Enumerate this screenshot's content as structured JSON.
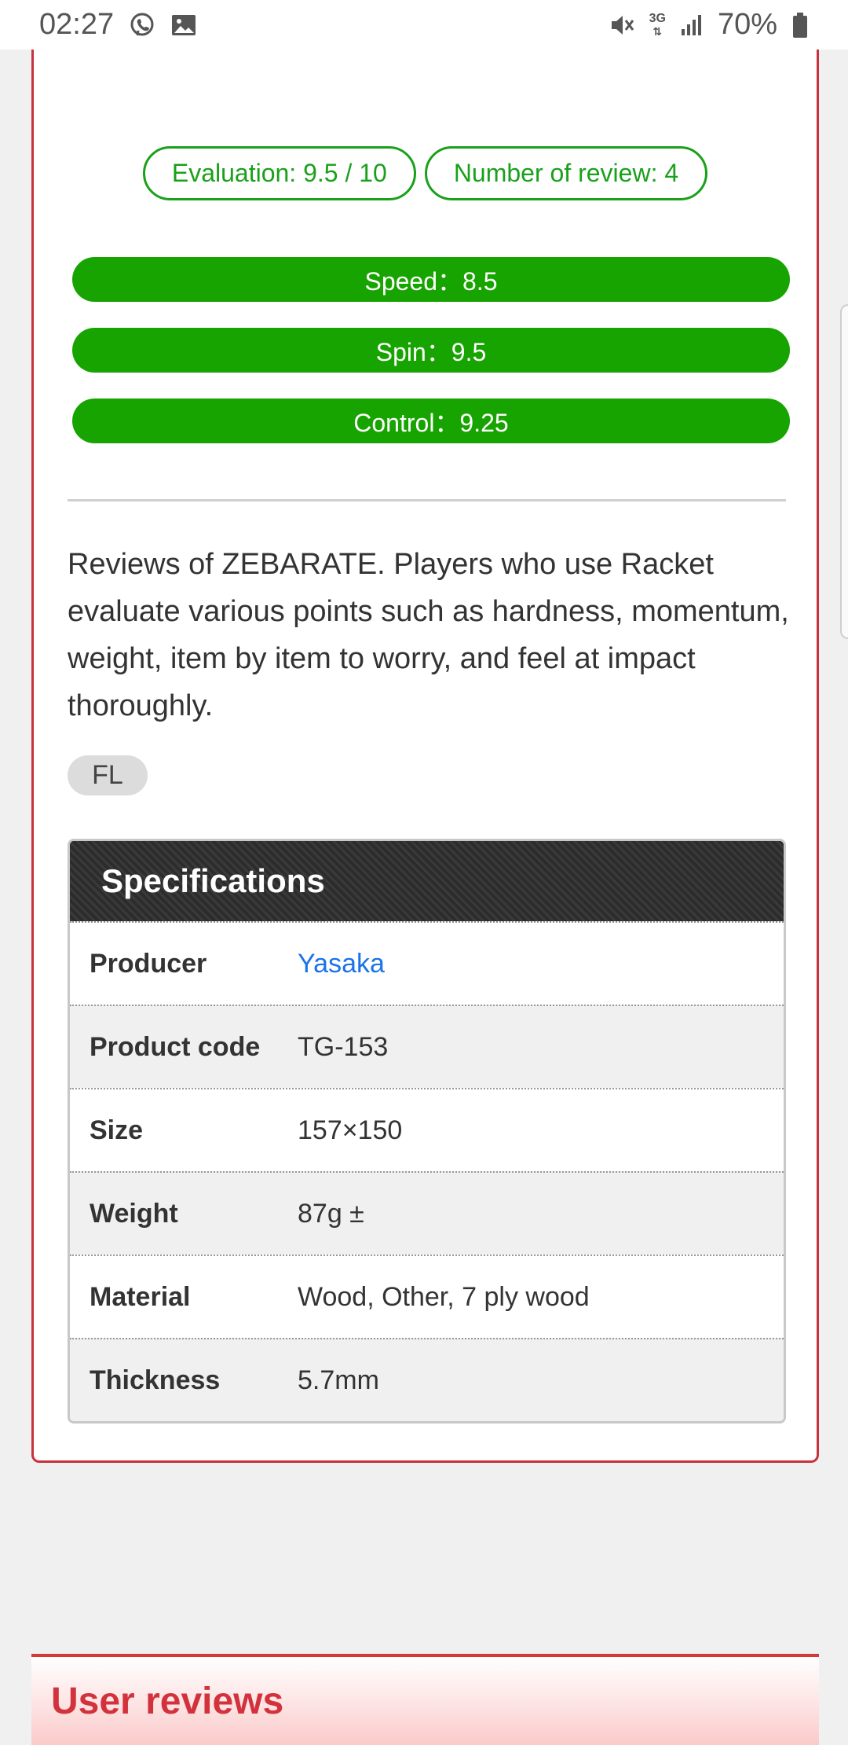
{
  "status_bar": {
    "time": "02:27",
    "network": "3G",
    "battery": "70%",
    "icons": [
      "viber-icon",
      "gallery-icon",
      "mute-icon",
      "signal-icon",
      "battery-icon"
    ]
  },
  "rating": {
    "evaluation": "Evaluation: 9.5 / 10",
    "review_count": "Number of review: 4"
  },
  "scores": [
    {
      "label": "Speed：8.5",
      "value": 8.5
    },
    {
      "label": "Spin：9.5",
      "value": 9.5
    },
    {
      "label": "Control：9.25",
      "value": 9.25
    }
  ],
  "description": "Reviews of ZEBARATE. Players who use Racket evaluate various points such as hardness, momentum, weight, item by item to worry, and feel at impact thoroughly.",
  "tag": "FL",
  "specifications": {
    "title": "Specifications",
    "rows": [
      {
        "label": "Producer",
        "value": "Yasaka"
      },
      {
        "label": "Product code",
        "value": "TG-153"
      },
      {
        "label": "Size",
        "value": "157×150"
      },
      {
        "label": "Weight",
        "value": "87g ±"
      },
      {
        "label": "Material",
        "value": "Wood, Other, 7 ply wood"
      },
      {
        "label": "Thickness",
        "value": "5.7mm"
      }
    ]
  },
  "user_reviews": {
    "title": "User reviews"
  },
  "colors": {
    "accent_green": "#18a400",
    "card_border_red": "#c8323c",
    "link_blue": "#1a73e8",
    "reviews_title_red": "#d2323c"
  }
}
